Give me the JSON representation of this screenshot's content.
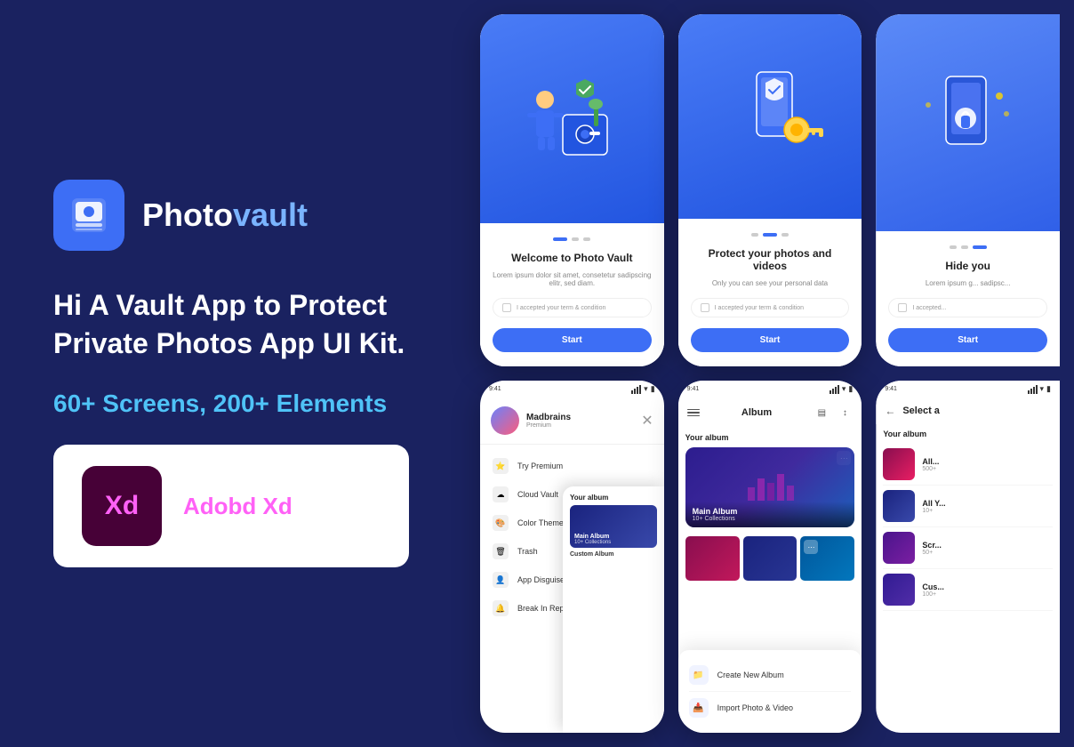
{
  "app": {
    "name_photo": "Photo",
    "name_vault": "vault",
    "tagline": "Hi A Vault App to Protect Private Photos App UI Kit.",
    "stats": "60+ Screens, 200+ Elements",
    "xd_label": "Adobd Xd"
  },
  "screens": {
    "onboard1": {
      "title": "Welcome to Photo Vault",
      "subtitle": "Lorem ipsum dolor sit amet, consetetur sadipscing elitr, sed diam.",
      "terms": "I accepted your term & condition",
      "start": "Start"
    },
    "onboard2": {
      "title": "Protect your photos and videos",
      "subtitle": "Only you can see your personal data",
      "terms": "I accepted your term & condition",
      "start": "Start"
    },
    "onboard3": {
      "title": "Hide you",
      "subtitle": "Lorem ipsum g... sadipsc...",
      "terms": "I accepted...",
      "start": "Start"
    },
    "menu": {
      "username": "Madbrains",
      "tier": "Premium",
      "items": [
        {
          "icon": "⭐",
          "label": "Try Premium"
        },
        {
          "icon": "☁",
          "label": "Cloud Vault"
        },
        {
          "icon": "🎨",
          "label": "Color Theme"
        },
        {
          "icon": "🗑",
          "label": "Trash"
        },
        {
          "icon": "👤",
          "label": "App Disguiser"
        },
        {
          "icon": "🔔",
          "label": "Break In Report"
        }
      ],
      "album_preview": {
        "title": "Your album",
        "name": "Main Album",
        "count": "10+ Collections"
      }
    },
    "album": {
      "title": "Album",
      "your_album": "Your album",
      "main_album": "Main Album",
      "main_count": "10+ Collections",
      "actions": [
        {
          "icon": "📁",
          "label": "Create New Album"
        },
        {
          "icon": "📥",
          "label": "Import Photo & Video"
        }
      ]
    },
    "select": {
      "title": "Select a",
      "your_album": "Your album",
      "items": [
        {
          "name": "All...",
          "count": "500+"
        },
        {
          "name": "All Y...",
          "count": "10+"
        },
        {
          "name": "Scr...",
          "count": "50+"
        },
        {
          "name": "Cus...",
          "count": "100+"
        }
      ]
    }
  },
  "status": {
    "time": "9:41",
    "time2": "9:41",
    "time3": "9:41"
  }
}
